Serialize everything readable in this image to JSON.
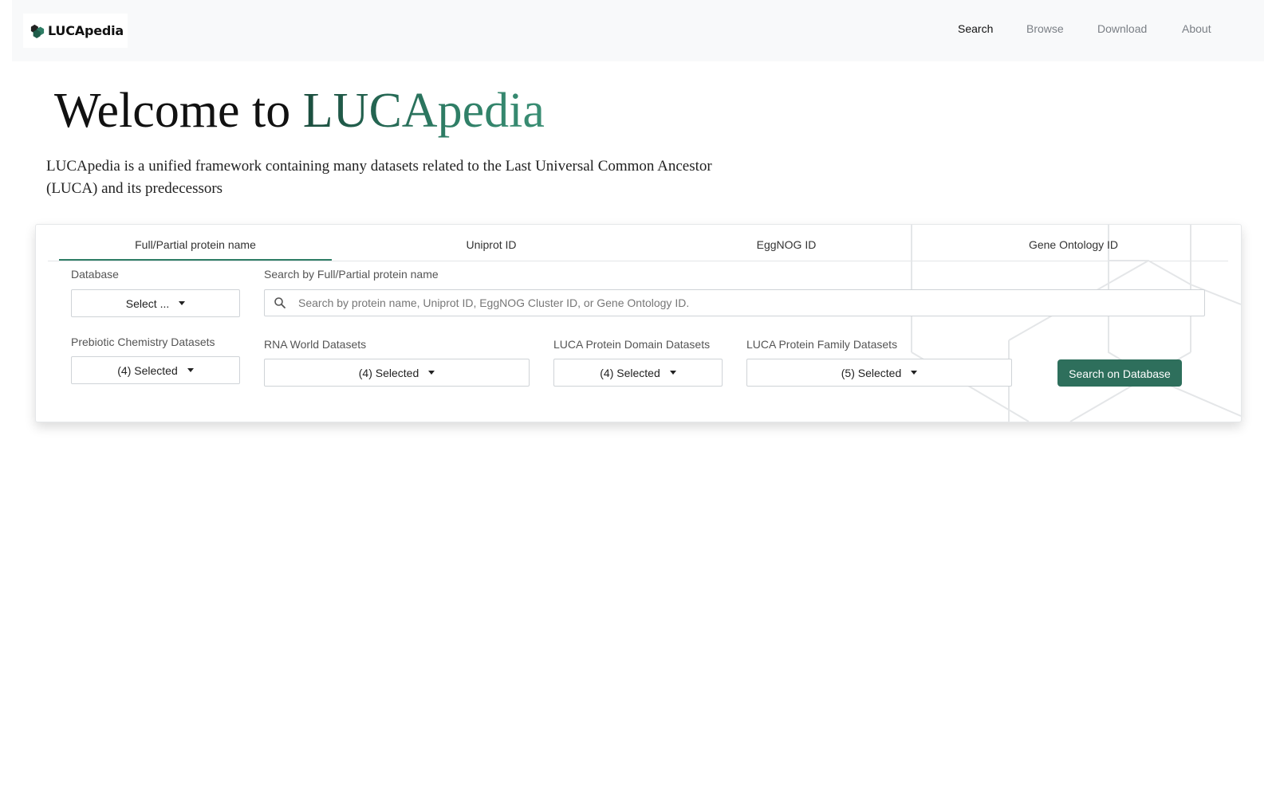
{
  "brand": {
    "name": "LUCApedia",
    "icon": "hexagon-logo-icon"
  },
  "nav": {
    "items": [
      {
        "label": "Search",
        "active": true
      },
      {
        "label": "Browse",
        "active": false
      },
      {
        "label": "Download",
        "active": false
      },
      {
        "label": "About",
        "active": false
      }
    ]
  },
  "hero": {
    "title_part1": "Welcome to",
    "title_part2": "LUCApedia",
    "description": "LUCApedia is a unified framework containing many datasets related to the Last Universal Common Ancestor (LUCA) and its predecessors"
  },
  "search": {
    "tabs": [
      {
        "label": "Full/Partial protein name",
        "active": true
      },
      {
        "label": "Uniprot ID",
        "active": false
      },
      {
        "label": "EggNOG ID",
        "active": false
      },
      {
        "label": "Gene Ontology ID",
        "active": false
      }
    ],
    "database_label": "Database",
    "database_value": "Select ...",
    "query_label": "Search by Full/Partial protein name",
    "query_placeholder": "Search by protein name, Uniprot ID, EggNOG Cluster ID, or Gene Ontology ID.",
    "query_value": "",
    "filters": [
      {
        "label": "Prebiotic Chemistry Datasets",
        "value": "(4) Selected"
      },
      {
        "label": "RNA World Datasets",
        "value": "(4) Selected"
      },
      {
        "label": "LUCA Protein Domain Datasets",
        "value": "(4) Selected"
      },
      {
        "label": "LUCA Protein Family Datasets",
        "value": "(5) Selected"
      }
    ],
    "submit_label": "Search on Database"
  },
  "colors": {
    "accent": "#2e6f5c",
    "accent_light": "#2e7d65",
    "navbar_bg": "#f8f9fa"
  }
}
